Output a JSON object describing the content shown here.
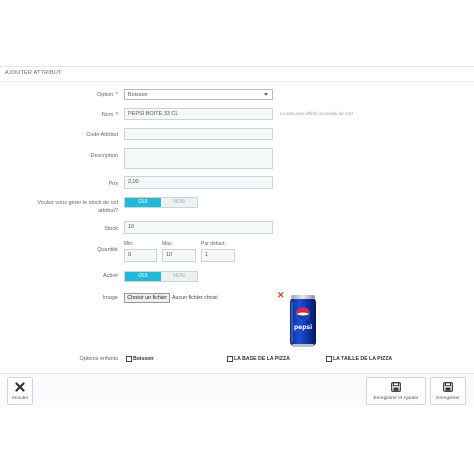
{
  "panel": {
    "title": "AJOUTER ATTRIBUT"
  },
  "form": {
    "option": {
      "label": "Option",
      "required_mark": "*",
      "value": "Boisson"
    },
    "nom": {
      "label": "Nom",
      "required_mark": "*",
      "value": "PEPSI BOITE 33 CL",
      "hint": "Le nom sera affiché au niveau du Cart"
    },
    "code": {
      "label": "Code Attribut",
      "value": ""
    },
    "description": {
      "label": "Description",
      "value": ""
    },
    "prix": {
      "label": "Prix",
      "value": "2,00"
    },
    "stock_manage": {
      "label_line1": "Voulez vous gérer le stock de cet",
      "label_line2": "attribut?",
      "on": "OUI",
      "off": "NON",
      "selected": "OUI"
    },
    "stock": {
      "label": "Stock",
      "value": "10"
    },
    "quantite": {
      "label": "Quantité",
      "min_label": "Min:",
      "min_value": "0",
      "max_label": "Max:",
      "max_value": "10",
      "default_label": "Par defaut:",
      "default_value": "1"
    },
    "active": {
      "label": "Active",
      "on": "OUI",
      "off": "NON",
      "selected": "OUI"
    },
    "image": {
      "label": "Image",
      "button": "Choisir un fichier",
      "file_text": "Aucun fichier choisi",
      "product": "Pepsi can",
      "brand_text": "pepsi"
    },
    "options_enfants": {
      "label": "Options enfants",
      "items": [
        "Boisson",
        "LA BASE DE LA PIZZA",
        "LA TAILLE DE LA PIZZA"
      ]
    }
  },
  "footer": {
    "cancel": "Annuler",
    "save_add": "Enregistrer et Ajouter",
    "save": "Enregistrer"
  },
  "colors": {
    "accent": "#25b9d7",
    "delete": "#e33b2e",
    "field_bg": "#f5f8f9"
  }
}
